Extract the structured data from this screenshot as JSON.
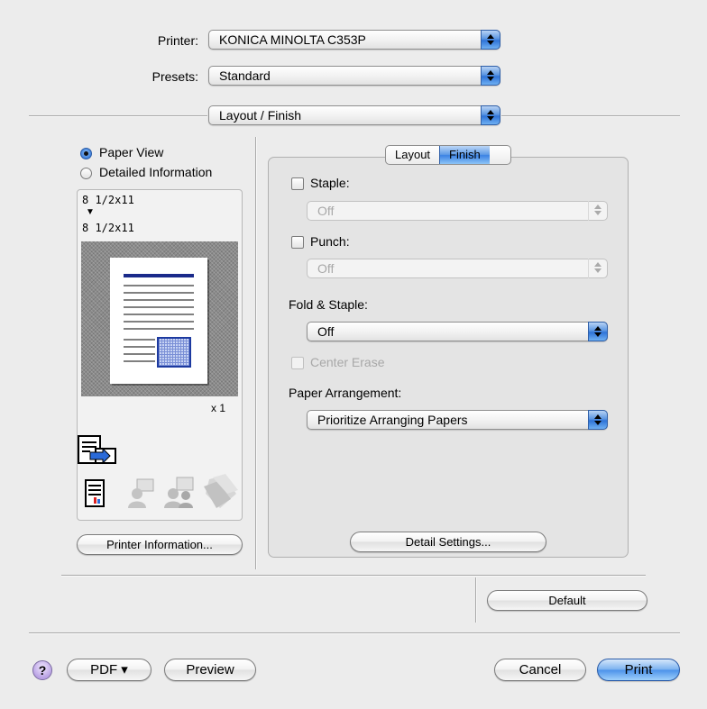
{
  "printer": {
    "label": "Printer:",
    "value": "KONICA MINOLTA C353P"
  },
  "presets": {
    "label": "Presets:",
    "value": "Standard"
  },
  "panel": {
    "value": "Layout / Finish"
  },
  "preview_mode": {
    "options": [
      {
        "label": "Paper View",
        "selected": true
      },
      {
        "label": "Detailed Information",
        "selected": false
      }
    ]
  },
  "preview": {
    "source_size": "8 1/2x11",
    "arrow": "▼",
    "output_size": "8 1/2x11",
    "copies": "x 1"
  },
  "tabs": [
    {
      "label": "Layout",
      "selected": false
    },
    {
      "label": "Finish",
      "selected": true
    }
  ],
  "finish": {
    "staple": {
      "label": "Staple:",
      "checked": false,
      "value": "Off",
      "enabled": false
    },
    "punch": {
      "label": "Punch:",
      "checked": false,
      "value": "Off",
      "enabled": false
    },
    "fold_staple": {
      "label": "Fold & Staple:",
      "value": "Off"
    },
    "center_erase": {
      "label": "Center Erase",
      "checked": false,
      "enabled": false
    },
    "paper_arrangement": {
      "label": "Paper Arrangement:",
      "value": "Prioritize Arranging Papers"
    },
    "detail_settings_label": "Detail Settings..."
  },
  "buttons": {
    "printer_information": "Printer Information...",
    "default": "Default",
    "help": "?",
    "pdf": "PDF ▾",
    "preview": "Preview",
    "cancel": "Cancel",
    "print": "Print"
  },
  "colors": {
    "accent": "#3b82e4",
    "help_purple": "#b9a2e4"
  }
}
